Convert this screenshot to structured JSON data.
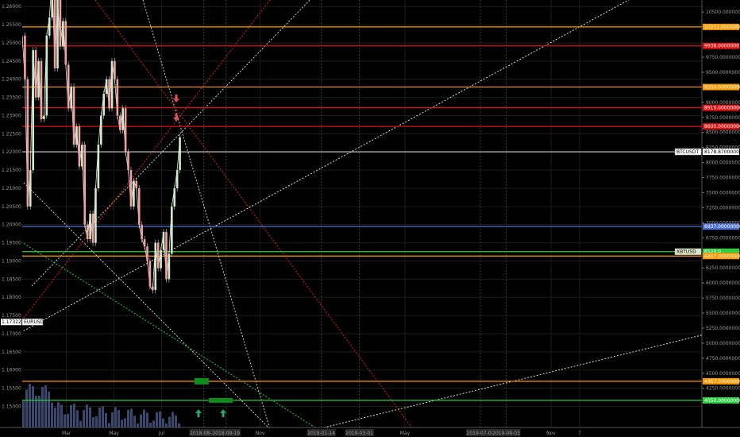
{
  "chart_data": {
    "type": "line",
    "title": "",
    "xlabel": "",
    "ylabel": "",
    "left_axis": {
      "ylim": [
        1.1442,
        1.2618
      ],
      "ticks": [
        "1.26000",
        "1.25500",
        "1.25000",
        "1.24500",
        "1.24000",
        "1.23500",
        "1.23000",
        "1.22500",
        "1.22000",
        "1.21500",
        "1.21000",
        "1.20500",
        "1.20000",
        "1.19500",
        "1.19000",
        "1.18500",
        "1.18000",
        "1.17500",
        "1.17000",
        "1.16500",
        "1.16000",
        "1.15500",
        "1.15000"
      ]
    },
    "right_axis": {
      "ylim": [
        3600,
        10700
      ],
      "ticks": [
        "10500.00000000",
        "10250.00000000",
        "9750.00000000",
        "9500.00000000",
        "9250.00000000",
        "9000.00000000",
        "8750.00000000",
        "8500.00000000",
        "8250.00000000",
        "8000.00000000",
        "7750.00000000",
        "7500.00000000",
        "7250.00000000",
        "7000.00000000",
        "6750.00000000",
        "6500.00000000",
        "6250.00000000",
        "6000.00000000",
        "5750.00000000",
        "5500.00000000",
        "5250.00000000",
        "5000.00000000",
        "4750.00000000",
        "4500.00000000",
        "4250.00000000"
      ]
    },
    "x_ticks": [
      {
        "pos": 0.065,
        "label": "Mar"
      },
      {
        "pos": 0.135,
        "label": "May"
      },
      {
        "pos": 0.205,
        "label": "Jul"
      },
      {
        "pos": 0.267,
        "label": "2018-08-22",
        "highlight": true
      },
      {
        "pos": 0.3,
        "label": "2018-09-19",
        "highlight": true
      },
      {
        "pos": 0.35,
        "label": "Nov"
      },
      {
        "pos": 0.44,
        "label": "2019-01-14",
        "highlight": true
      },
      {
        "pos": 0.496,
        "label": "2019-03-01",
        "highlight": true
      },
      {
        "pos": 0.563,
        "label": "May"
      },
      {
        "pos": 0.674,
        "label": "2019-07-08",
        "highlight": true
      },
      {
        "pos": 0.712,
        "label": "2019-09-03",
        "highlight": true
      },
      {
        "pos": 0.778,
        "label": "Nov"
      },
      {
        "pos": 0.82,
        "label": "7"
      }
    ],
    "series": [
      {
        "name": "EURUSD",
        "axis": "left",
        "color": "#ffffff",
        "last_value": "1.17322",
        "x": [
          0.0,
          0.004,
          0.008,
          0.012,
          0.016,
          0.02,
          0.024,
          0.028,
          0.032,
          0.036,
          0.04,
          0.044,
          0.048,
          0.052,
          0.056,
          0.06,
          0.064,
          0.068,
          0.072,
          0.076,
          0.08,
          0.084,
          0.088,
          0.092,
          0.096,
          0.1,
          0.104,
          0.108,
          0.112,
          0.116,
          0.12,
          0.124,
          0.128,
          0.132,
          0.136,
          0.14,
          0.144,
          0.148,
          0.152,
          0.156,
          0.16,
          0.164,
          0.168,
          0.172,
          0.176,
          0.18,
          0.184,
          0.188,
          0.192,
          0.196,
          0.2,
          0.204,
          0.208,
          0.212,
          0.216,
          0.22,
          0.224,
          0.228,
          0.232
        ],
        "values": [
          1.252,
          1.24,
          1.205,
          1.215,
          1.248,
          1.235,
          1.245,
          1.229,
          1.23,
          1.252,
          1.257,
          1.268,
          1.243,
          1.262,
          1.249,
          1.256,
          1.244,
          1.232,
          1.238,
          1.222,
          1.227,
          1.216,
          1.222,
          1.2,
          1.196,
          1.203,
          1.195,
          1.21,
          1.222,
          1.23,
          1.236,
          1.24,
          1.232,
          1.245,
          1.24,
          1.23,
          1.226,
          1.232,
          1.22,
          1.215,
          1.205,
          1.212,
          1.21,
          1.2,
          1.196,
          1.194,
          1.19,
          1.183,
          1.182,
          1.195,
          1.188,
          1.193,
          1.198,
          1.185,
          1.192,
          1.205,
          1.21,
          1.215,
          1.224
        ]
      }
    ],
    "horizontal_levels": [
      {
        "value": "10253.00000000",
        "axis": "right",
        "color": "#ff9900"
      },
      {
        "value": "9938.00000001",
        "axis": "right",
        "color": "#e01010"
      },
      {
        "value": "9254.00000000",
        "axis": "right",
        "color": "#ff9900"
      },
      {
        "value": "8910.00000000",
        "axis": "right",
        "color": "#e01010"
      },
      {
        "value": "8600.00000000",
        "axis": "right",
        "color": "#e01010"
      },
      {
        "value": "8178.87000000",
        "axis": "right",
        "color": "#cccccc",
        "tag": "BTCUSDT"
      },
      {
        "value": "6937.00000000",
        "axis": "right",
        "color": "#4a6fd0"
      },
      {
        "value": "6520.0",
        "axis": "right",
        "color": "#2ecc40",
        "tag": "XBTUSD"
      },
      {
        "value": "6447.00000000",
        "axis": "right",
        "color": "#ff9900"
      },
      {
        "value": "4367.50000000",
        "axis": "right",
        "color": "#ff9900"
      },
      {
        "value": "4050.00000000",
        "axis": "right",
        "color": "#2ecc40"
      }
    ],
    "grid": true,
    "legend": "none"
  }
}
